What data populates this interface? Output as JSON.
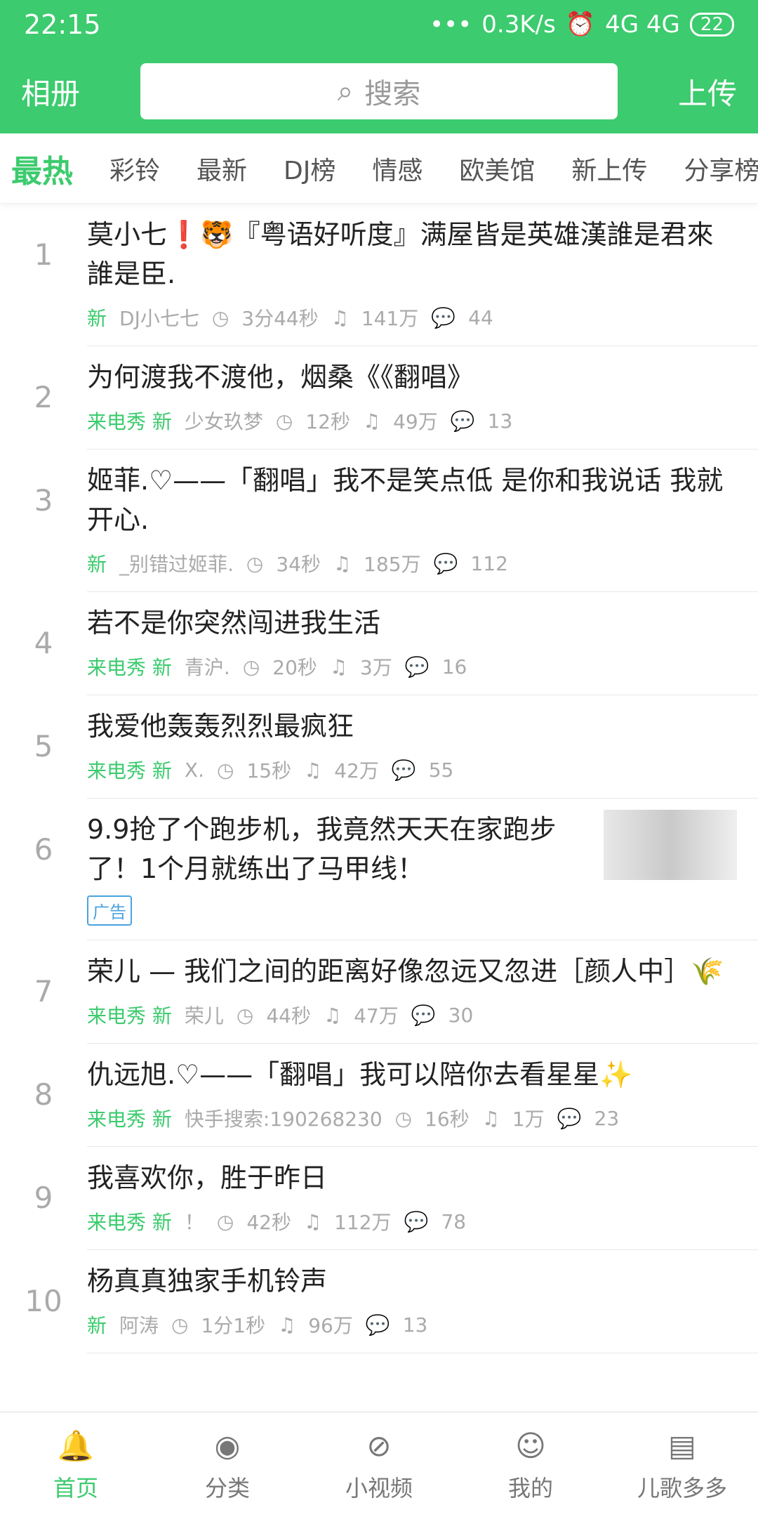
{
  "status": {
    "time": "22:15",
    "network": "0.3K/s",
    "signal": "4G 4G",
    "battery": "22"
  },
  "header": {
    "album": "相册",
    "search_placeholder": "搜索",
    "upload": "上传"
  },
  "tabs": [
    "最热",
    "彩铃",
    "最新",
    "DJ榜",
    "情感",
    "欧美馆",
    "新上传",
    "分享榜"
  ],
  "items": [
    {
      "index": "1",
      "title": "莫小七❗🐯『粤语好听度』满屋皆是英雄漢誰是君來誰是臣.",
      "tags": "新",
      "author": "DJ小七七",
      "duration": "3分44秒",
      "plays": "141万",
      "comments": "44"
    },
    {
      "index": "2",
      "title": "为何渡我不渡他，烟桑《《翻唱》",
      "tags": "来电秀 新",
      "author": "少女玖梦",
      "duration": "12秒",
      "plays": "49万",
      "comments": "13"
    },
    {
      "index": "3",
      "title": "姬菲.♡——「翻唱」我不是笑点低 是你和我说话 我就开心.",
      "tags": "新",
      "author": "_别错过姬菲.",
      "duration": "34秒",
      "plays": "185万",
      "comments": "112"
    },
    {
      "index": "4",
      "title": "若不是你突然闯进我生活",
      "tags": "来电秀 新",
      "author": "青沪.",
      "duration": "20秒",
      "plays": "3万",
      "comments": "16"
    },
    {
      "index": "5",
      "title": "我爱他轰轰烈烈最疯狂",
      "tags": "来电秀 新",
      "author": "X.",
      "duration": "15秒",
      "plays": "42万",
      "comments": "55"
    },
    {
      "index": "6",
      "title": "9.9抢了个跑步机，我竟然天天在家跑步了！1个月就练出了马甲线！",
      "ad": "广告"
    },
    {
      "index": "7",
      "title": "荣儿 — 我们之间的距离好像忽远又忽进［颜人中］🌾",
      "tags": "来电秀 新",
      "author": "荣儿",
      "duration": "44秒",
      "plays": "47万",
      "comments": "30"
    },
    {
      "index": "8",
      "title": "仇远旭.♡——「翻唱」我可以陪你去看星星✨",
      "tags": "来电秀 新",
      "author": "快手搜索:190268230",
      "duration": "16秒",
      "plays": "1万",
      "comments": "23"
    },
    {
      "index": "9",
      "title": "我喜欢你，胜于昨日",
      "tags": "来电秀 新",
      "author": "！",
      "duration": "42秒",
      "plays": "112万",
      "comments": "78"
    },
    {
      "index": "10",
      "title": "杨真真独家手机铃声",
      "tags": "新",
      "author": "阿涛",
      "duration": "1分1秒",
      "plays": "96万",
      "comments": "13"
    }
  ],
  "nav": [
    "首页",
    "分类",
    "小视频",
    "我的",
    "儿歌多多"
  ]
}
